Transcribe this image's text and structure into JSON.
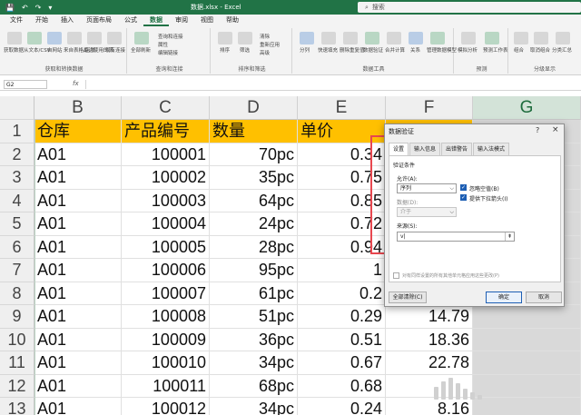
{
  "titlebar": {
    "file_title": "数据.xlsx  -  Excel",
    "search_label": "搜索"
  },
  "menu": [
    "文件",
    "开始",
    "插入",
    "页面布局",
    "公式",
    "数据",
    "审阅",
    "视图",
    "帮助"
  ],
  "menu_active_index": 5,
  "ribbon": {
    "groups": [
      {
        "label": "获取和转换数据",
        "buttons": [
          "获取数据",
          "从文本/CSV",
          "自网站",
          "来自表格/区域",
          "最近使用的源",
          "现有连接"
        ]
      },
      {
        "label": "查询和连接",
        "buttons": [
          "全部刷新",
          "查询和连接",
          "属性",
          "编辑链接"
        ]
      },
      {
        "label": "排序和筛选",
        "buttons": [
          "排序",
          "筛选",
          "清除",
          "重新应用",
          "高级"
        ]
      },
      {
        "label": "数据工具",
        "buttons": [
          "分列",
          "快速填充",
          "删除重复值",
          "数据验证",
          "合并计算",
          "关系",
          "管理数据模型"
        ]
      },
      {
        "label": "预测",
        "buttons": [
          "模拟分析",
          "预测工作表"
        ]
      },
      {
        "label": "分级显示",
        "buttons": [
          "组合",
          "取消组合",
          "分类汇总"
        ]
      }
    ]
  },
  "formulabar": {
    "name_box": "G2",
    "fx_label": "fx",
    "value": ""
  },
  "grid": {
    "columns": [
      "B",
      "C",
      "D",
      "E",
      "F",
      "G"
    ],
    "selected_column": "G",
    "rows": [
      {
        "n": "1",
        "cells": [
          "仓库",
          "产品编号",
          "数量",
          "单价",
          "",
          ""
        ]
      },
      {
        "n": "2",
        "cells": [
          "A01",
          "100001",
          "70pc",
          "0.34",
          "",
          ""
        ]
      },
      {
        "n": "3",
        "cells": [
          "A01",
          "100002",
          "35pc",
          "0.75",
          "",
          ""
        ]
      },
      {
        "n": "4",
        "cells": [
          "A01",
          "100003",
          "64pc",
          "0.85",
          "",
          ""
        ]
      },
      {
        "n": "5",
        "cells": [
          "A01",
          "100004",
          "24pc",
          "0.72",
          "",
          ""
        ]
      },
      {
        "n": "6",
        "cells": [
          "A01",
          "100005",
          "28pc",
          "0.94",
          "",
          ""
        ]
      },
      {
        "n": "7",
        "cells": [
          "A01",
          "100006",
          "95pc",
          "1",
          "",
          ""
        ]
      },
      {
        "n": "8",
        "cells": [
          "A01",
          "100007",
          "61pc",
          "0.2",
          "",
          ""
        ]
      },
      {
        "n": "9",
        "cells": [
          "A01",
          "100008",
          "51pc",
          "0.29",
          "14.79",
          ""
        ]
      },
      {
        "n": "10",
        "cells": [
          "A01",
          "100009",
          "36pc",
          "0.51",
          "18.36",
          ""
        ]
      },
      {
        "n": "11",
        "cells": [
          "A01",
          "100010",
          "34pc",
          "0.67",
          "22.78",
          ""
        ]
      },
      {
        "n": "12",
        "cells": [
          "A01",
          "100011",
          "68pc",
          "0.68",
          "",
          ""
        ]
      },
      {
        "n": "13",
        "cells": [
          "A01",
          "100012",
          "34pc",
          "0.24",
          "8.16",
          ""
        ]
      }
    ]
  },
  "dialog": {
    "title": "数据验证",
    "help": "?",
    "close": "×",
    "tabs": [
      "设置",
      "输入信息",
      "出错警告",
      "输入法模式"
    ],
    "active_tab": 0,
    "section_label": "验证条件",
    "allow_label": "允许(A):",
    "allow_value": "序列",
    "ignore_blank": "忽略空值(B)",
    "dropdown_arrow": "提供下拉箭头(I)",
    "data_label": "数据(D):",
    "data_value": "介于",
    "source_label": "来源(S):",
    "source_value": "v|",
    "apply_all": "对有同样设置的所有其他单元格应用这些更改(P)",
    "clear_all": "全部清除(C)",
    "ok": "确定",
    "cancel": "取消"
  },
  "colors": {
    "excel_green": "#217346",
    "header_fill": "#ffc000",
    "highlight_red": "#e8474f"
  }
}
